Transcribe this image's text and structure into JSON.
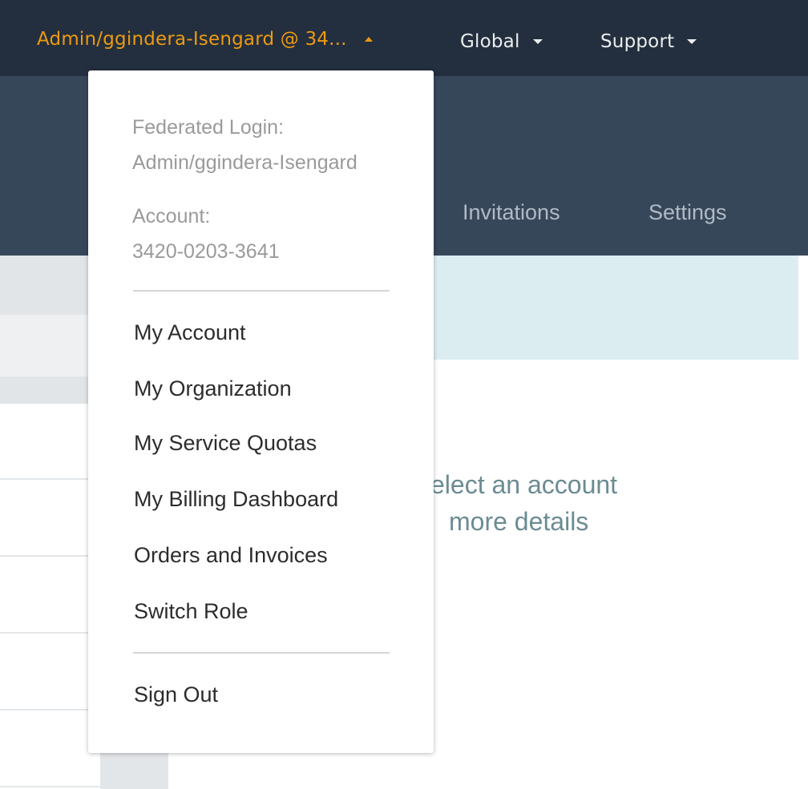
{
  "topbar": {
    "account_label": "Admin/ggindera-Isengard @ 34...",
    "region_label": "Global",
    "support_label": "Support",
    "account_caret_icon": "caret-up-icon",
    "dropdown_caret_icon": "caret-down-icon",
    "background": "#232f3e",
    "accent": "#ec9a12"
  },
  "subnav": {
    "tabs": [
      {
        "label": "Invitations"
      },
      {
        "label": "Settings"
      }
    ],
    "background": "#37475a"
  },
  "main": {
    "empty_state": {
      "line1": "elect an account",
      "line2": "more details"
    },
    "info_banner_color": "#dcedf1"
  },
  "account_menu": {
    "federated_label": "Federated Login:",
    "federated_value": "Admin/ggindera-Isengard",
    "account_label": "Account:",
    "account_value": "3420-0203-3641",
    "items": [
      {
        "label": "My Account"
      },
      {
        "label": "My Organization"
      },
      {
        "label": "My Service Quotas"
      },
      {
        "label": "My Billing Dashboard"
      },
      {
        "label": "Orders and Invoices"
      },
      {
        "label": "Switch Role"
      }
    ],
    "sign_out_label": "Sign Out"
  }
}
